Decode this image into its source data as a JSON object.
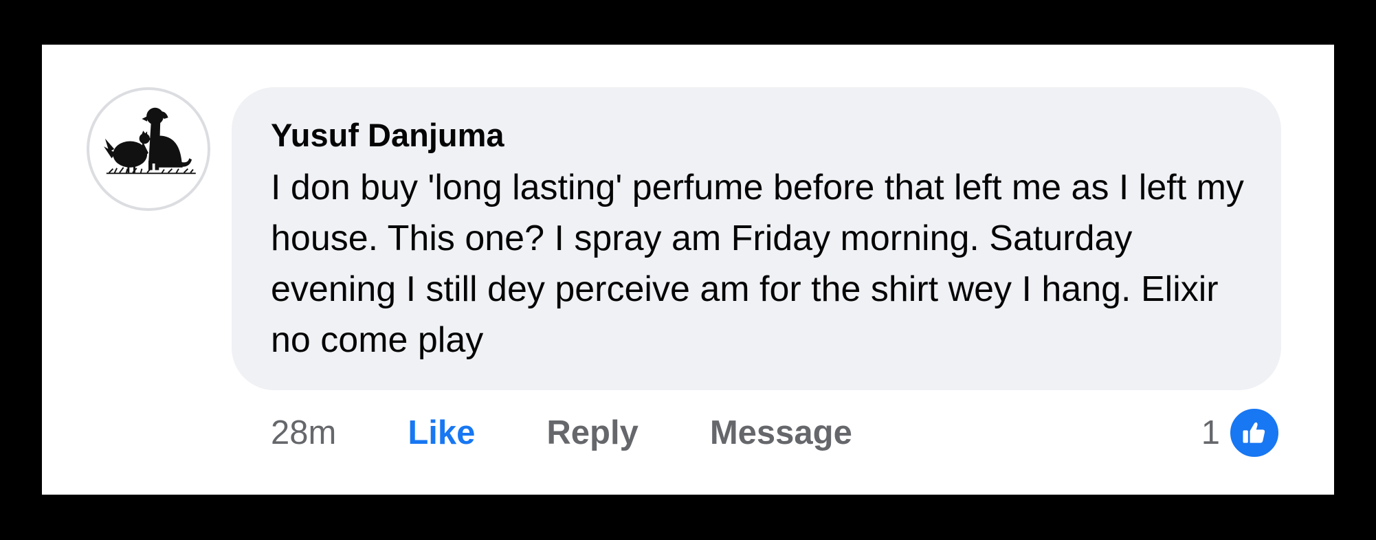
{
  "comment": {
    "author": "Yusuf Danjuma",
    "text": "I don buy 'long lasting' perfume before that left me as I left my house. This one? I spray am Friday morning. Saturday evening I still dey perceive am for the shirt wey I hang. Elixir no come play",
    "avatar_icon": "chicken-and-dog-silhouette-icon"
  },
  "actions": {
    "timestamp": "28m",
    "like_label": "Like",
    "reply_label": "Reply",
    "message_label": "Message"
  },
  "reactions": {
    "count": "1",
    "icon": "thumbs-up-icon"
  },
  "colors": {
    "bubble_background": "#f0f1f5",
    "like_blue": "#1877f2",
    "secondary_text": "#65676b",
    "primary_text": "#050505"
  }
}
